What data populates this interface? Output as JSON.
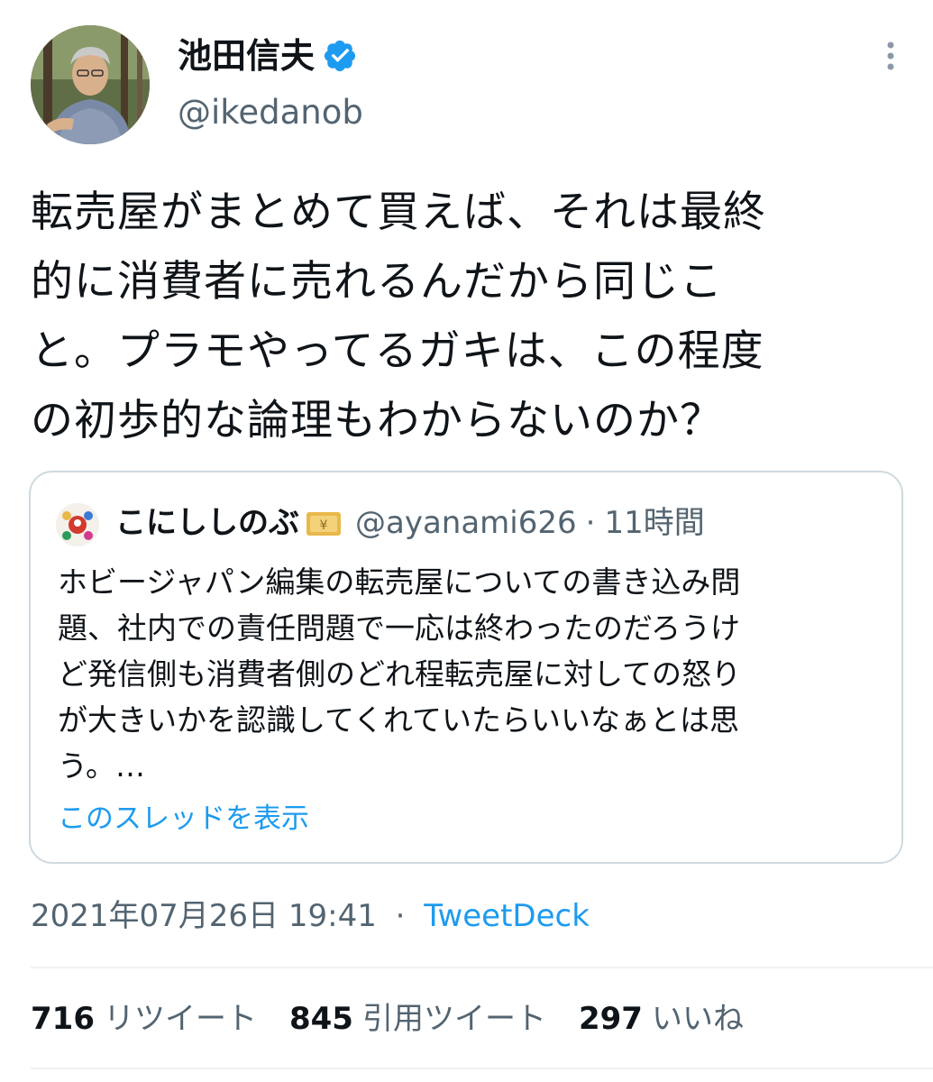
{
  "author": {
    "name": "池田信夫",
    "handle": "@ikedanob"
  },
  "icons": {
    "verified": "verified-badge-icon",
    "more": "more-vertical-icon",
    "money": "money-with-wings-icon"
  },
  "tweet": {
    "lines": [
      "転売屋がまとめて買えば、それは最終",
      "的に消費者に売れるんだから同じこ",
      "と。プラモやってるガキは、この程度",
      "の初歩的な論理もわからないのか？"
    ]
  },
  "quote": {
    "name": "こにししのぶ",
    "handle": "@ayanami626",
    "separator": "·",
    "time": "11時間",
    "lines": [
      "ホビージャパン編集の転売屋についての書き込み問",
      "題、社内での責任問題で一応は終わったのだろうけ",
      "ど発信側も消費者側のどれ程転売屋に対しての怒り",
      "が大きいかを認識してくれていたらいいなぁとは思",
      "う。…"
    ],
    "show_thread": "このスレッドを表示"
  },
  "meta": {
    "date": "2021年07月26日 19:41",
    "separator": "·",
    "source": "TweetDeck"
  },
  "stats": [
    {
      "count": "716",
      "label": "リツイート"
    },
    {
      "count": "845",
      "label": "引用ツイート"
    },
    {
      "count": "297",
      "label": "いいね"
    }
  ],
  "colors": {
    "text": "#0f1419",
    "secondary": "#536471",
    "link": "#1d9bf0",
    "border": "#cfd9de",
    "verified": "#1d9bf0"
  }
}
